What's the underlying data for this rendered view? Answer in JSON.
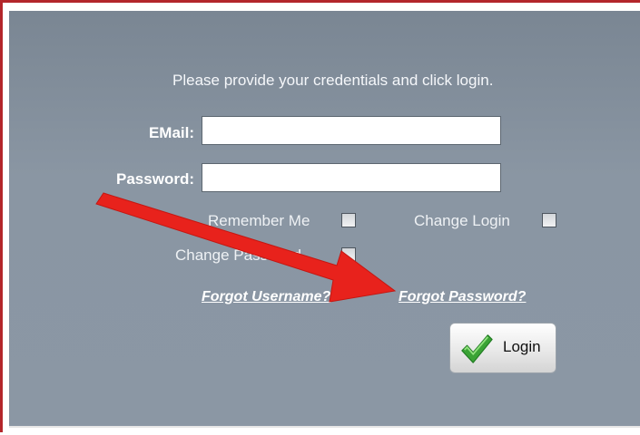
{
  "dialog": {
    "instruction": "Please provide your credentials and click login.",
    "email_label": "EMail:",
    "email_value": "",
    "password_label": "Password:",
    "password_value": "",
    "remember_me_label": "Remember Me",
    "change_login_label": "Change Login",
    "change_password_label": "Change Password",
    "forgot_username_link": "Forgot Username?",
    "forgot_password_link": "Forgot Password?",
    "login_button": "Login"
  },
  "annotation": {
    "arrow_color": "#e8221c",
    "points_to": "forgot-password-link"
  },
  "colors": {
    "panel_bg": "#8a96a3",
    "frame_border": "#b3262b",
    "checkmark": "#3aa335"
  },
  "icons": {
    "login": "checkmark-icon"
  }
}
